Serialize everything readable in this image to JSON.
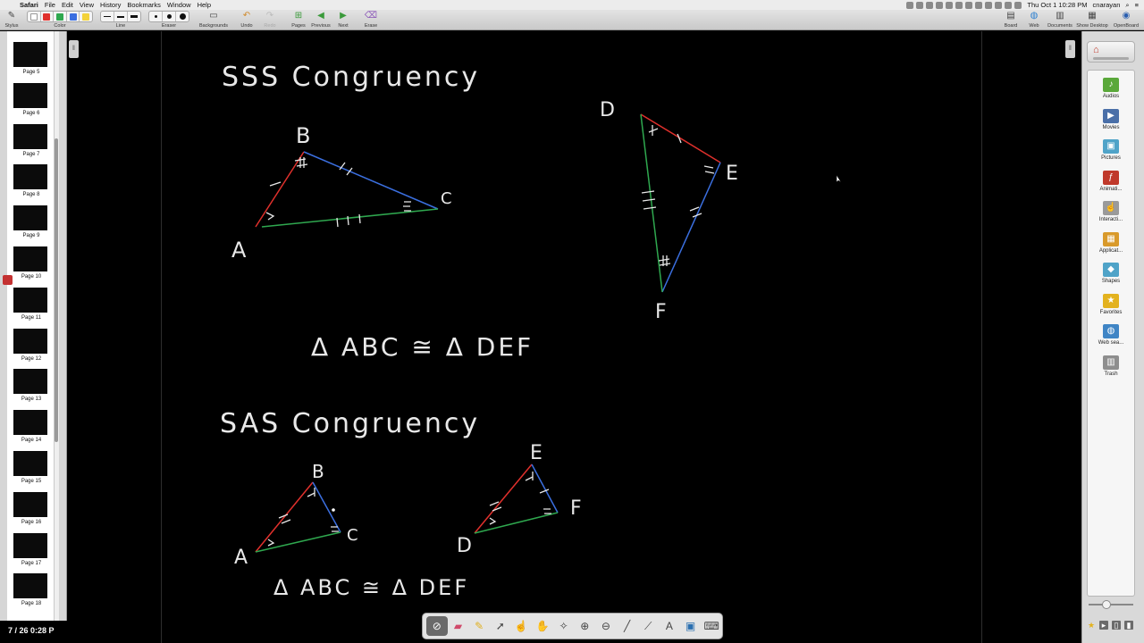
{
  "menubar": {
    "app_name": "Safari",
    "items": [
      "File",
      "Edit",
      "View",
      "History",
      "Bookmarks",
      "Window",
      "Help"
    ],
    "clock": "Thu Oct 1  10:28 PM",
    "user": "cnarayan"
  },
  "toolbar": {
    "stylus_label": "Stylus",
    "color_label": "Color",
    "line_label": "Line",
    "eraser_label": "Eraser",
    "backgrounds_label": "Backgrounds",
    "undo_label": "Undo",
    "redo_label": "Redo",
    "pages_label": "Pages",
    "previous_label": "Previous",
    "next_label": "Next",
    "erase_label": "Erase",
    "board_label": "Board",
    "web_label": "Web",
    "documents_label": "Documents",
    "show_desktop_label": "Show Desktop",
    "openboard_label": "OpenBoard",
    "colors": [
      "#ffffff",
      "#e0302c",
      "#2fa84f",
      "#3b6fe0",
      "#f3d23a"
    ]
  },
  "pages": {
    "items": [
      {
        "label": "Page 5"
      },
      {
        "label": "Page 6"
      },
      {
        "label": "Page 7"
      },
      {
        "label": "Page 8"
      },
      {
        "label": "Page 9"
      },
      {
        "label": "Page 10"
      },
      {
        "label": "Page 11"
      },
      {
        "label": "Page 12"
      },
      {
        "label": "Page 13"
      },
      {
        "label": "Page 14"
      },
      {
        "label": "Page 15"
      },
      {
        "label": "Page 16"
      },
      {
        "label": "Page 17"
      },
      {
        "label": "Page 18"
      }
    ],
    "indicator": "7 / 26 0:28 P"
  },
  "board": {
    "sss_title": "SSS  Congruency",
    "sss_labels": {
      "A": "A",
      "B": "B",
      "C": "C",
      "D": "D",
      "E": "E",
      "F": "F"
    },
    "sss_statement": "Δ ABC ≅ Δ DEF",
    "sas_title": "SAS  Congruency",
    "sas_labels": {
      "A": "A",
      "B": "B",
      "C": "C",
      "D": "D",
      "E": "E",
      "F": "F"
    },
    "sas_statement": "Δ ABC ≅ Δ DEF"
  },
  "library": {
    "items": [
      {
        "label": "Audios",
        "icon": "audio-icon",
        "color": "#5aa83a"
      },
      {
        "label": "Movies",
        "icon": "movie-icon",
        "color": "#4a6fa8"
      },
      {
        "label": "Pictures",
        "icon": "picture-icon",
        "color": "#4fa3c8"
      },
      {
        "label": "Animati...",
        "icon": "flash-icon",
        "color": "#c0392b"
      },
      {
        "label": "Interacti...",
        "icon": "hand-icon",
        "color": "#9a9a9a"
      },
      {
        "label": "Applicat...",
        "icon": "apps-icon",
        "color": "#d99a2b"
      },
      {
        "label": "Shapes",
        "icon": "shapes-icon",
        "color": "#4fa3c8"
      },
      {
        "label": "Favorites",
        "icon": "star-icon",
        "color": "#e3b21e"
      },
      {
        "label": "Web sea...",
        "icon": "globe-icon",
        "color": "#3f85c5"
      },
      {
        "label": "Trash",
        "icon": "trash-icon",
        "color": "#8e8e8e"
      }
    ]
  },
  "palette": {
    "tools": [
      "pen",
      "eraser",
      "marker",
      "selector",
      "interactor",
      "hand",
      "laser",
      "zoom-in",
      "zoom-out",
      "line",
      "straight-line",
      "text",
      "capture",
      "virtual-keyboard"
    ],
    "active": "pen"
  }
}
